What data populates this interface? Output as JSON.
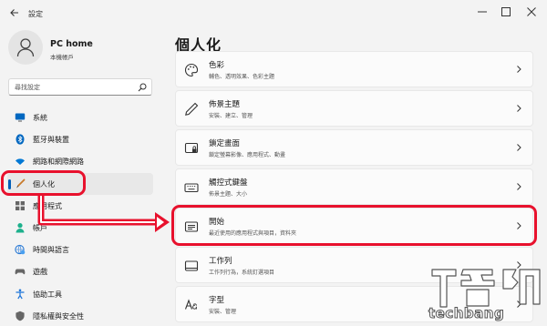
{
  "window": {
    "title": "設定"
  },
  "profile": {
    "name": "PC home",
    "account_type": "本機帳戶"
  },
  "search": {
    "placeholder": "尋找設定"
  },
  "sidebar": {
    "items": [
      {
        "label": "系統",
        "icon": "monitor-icon"
      },
      {
        "label": "藍牙與裝置",
        "icon": "bluetooth-icon"
      },
      {
        "label": "網路和網際網路",
        "icon": "wifi-icon"
      },
      {
        "label": "個人化",
        "icon": "brush-icon",
        "active": true
      },
      {
        "label": "應用程式",
        "icon": "apps-icon"
      },
      {
        "label": "帳戶",
        "icon": "account-icon"
      },
      {
        "label": "時間與語言",
        "icon": "globe-clock-icon"
      },
      {
        "label": "遊戲",
        "icon": "gamepad-icon"
      },
      {
        "label": "協助工具",
        "icon": "accessibility-icon"
      },
      {
        "label": "隱私權與安全性",
        "icon": "shield-icon"
      }
    ]
  },
  "main": {
    "title": "個人化",
    "cards": [
      {
        "title": "色彩",
        "subtitle": "輔色、透明效果、色彩主題",
        "icon": "palette-icon"
      },
      {
        "title": "佈景主題",
        "subtitle": "安裝、建立、管理",
        "icon": "pen-icon"
      },
      {
        "title": "鎖定畫面",
        "subtitle": "鎖定螢幕影像、應用程式、動畫",
        "icon": "lock-screen-icon"
      },
      {
        "title": "觸控式鍵盤",
        "subtitle": "佈景主題、大小",
        "icon": "keyboard-icon"
      },
      {
        "title": "開始",
        "subtitle": "最近使用的應用程式與項目，資料夾",
        "icon": "start-icon"
      },
      {
        "title": "工作列",
        "subtitle": "工作列行為，系統釘選項目",
        "icon": "taskbar-icon"
      },
      {
        "title": "字型",
        "subtitle": "安裝、管理",
        "icon": "font-icon"
      }
    ]
  },
  "watermark": {
    "text": "techbang"
  },
  "colors": {
    "accent": "#005fb8",
    "annotation": "#e8112d",
    "background": "#f3f3f3",
    "card": "#fbfbfb"
  }
}
